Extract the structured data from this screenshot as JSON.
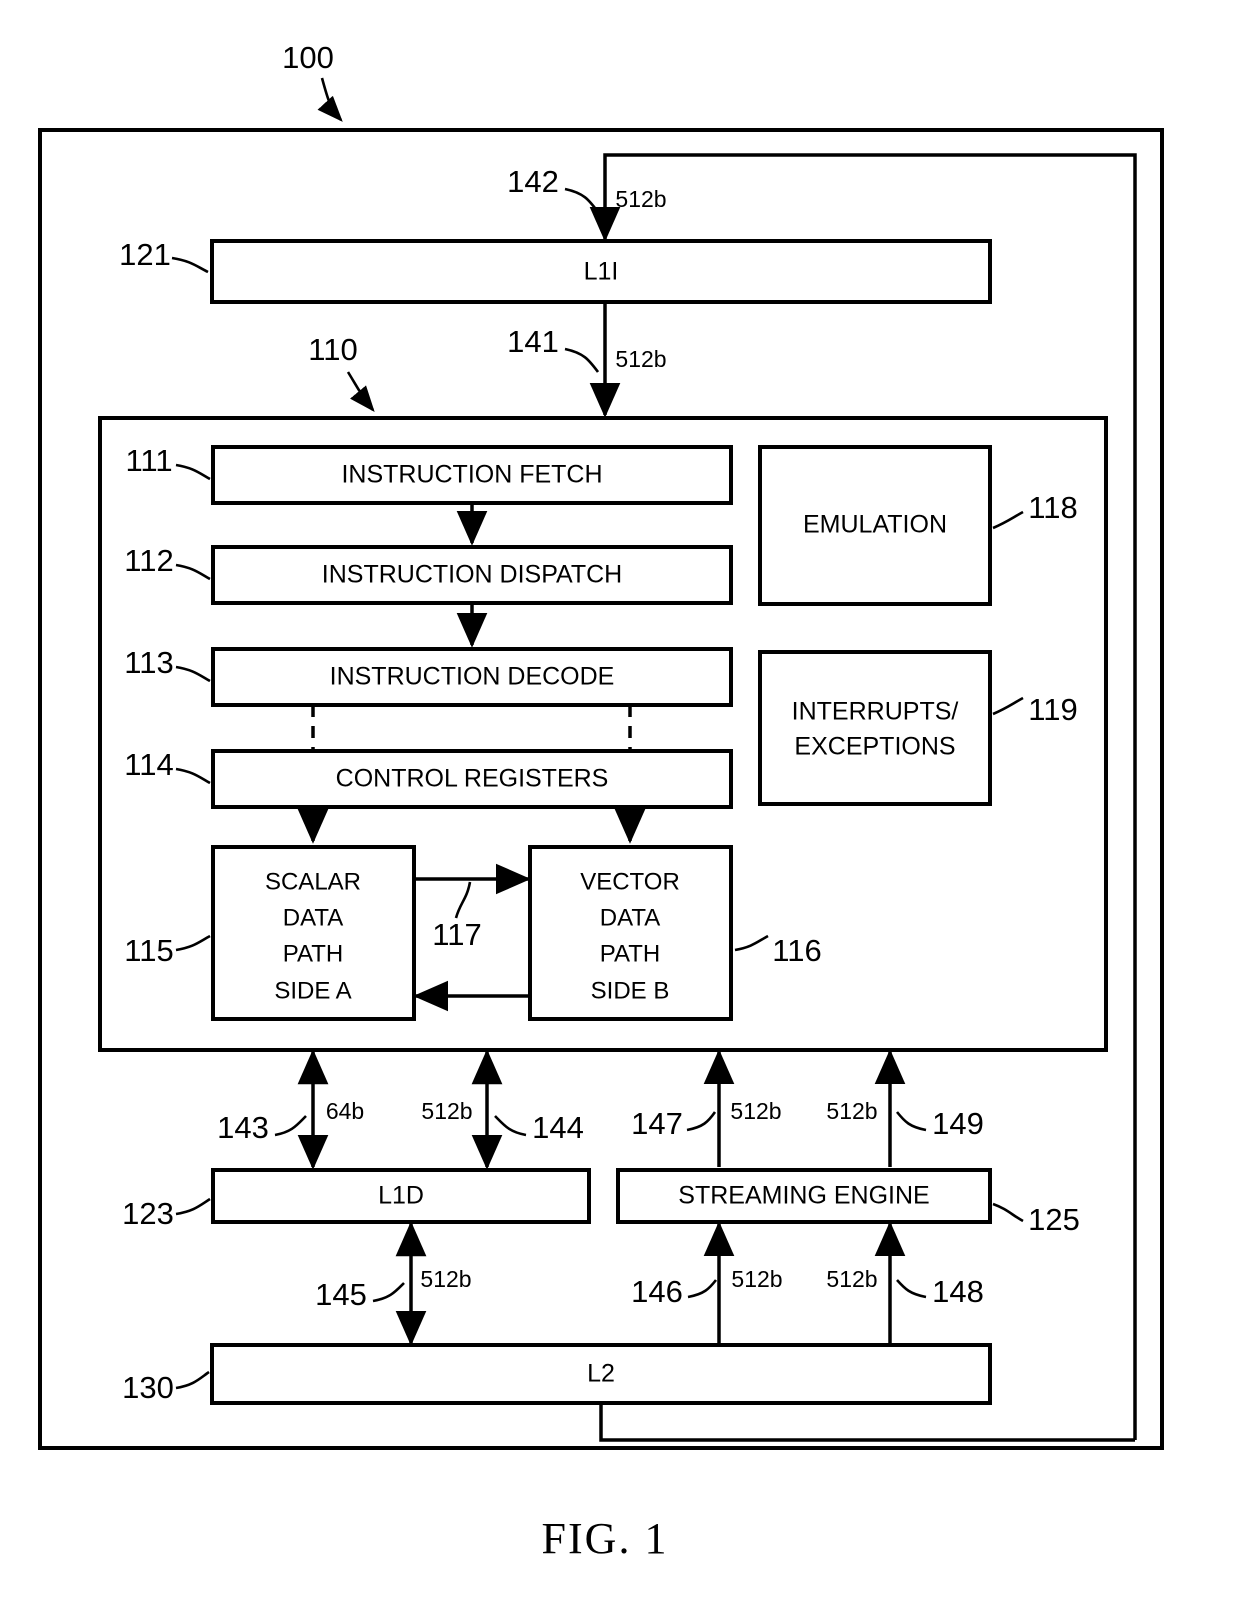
{
  "figure": {
    "caption": "FIG. 1",
    "system_ref": "100"
  },
  "blocks": {
    "l1i": {
      "label": "L1I",
      "ref": "121"
    },
    "cpu_core": {
      "ref": "110"
    },
    "instruction_fetch": {
      "label": "INSTRUCTION FETCH",
      "ref": "111"
    },
    "instruction_dispatch": {
      "label": "INSTRUCTION DISPATCH",
      "ref": "112"
    },
    "instruction_decode": {
      "label": "INSTRUCTION DECODE",
      "ref": "113"
    },
    "control_registers": {
      "label": "CONTROL REGISTERS",
      "ref": "114"
    },
    "scalar_data_path": {
      "line1": "SCALAR",
      "line2": "DATA",
      "line3": "PATH",
      "line4": "SIDE A",
      "ref": "115"
    },
    "vector_data_path": {
      "line1": "VECTOR",
      "line2": "DATA",
      "line3": "PATH",
      "line4": "SIDE B",
      "ref": "116"
    },
    "datapath_crosslink": {
      "ref": "117"
    },
    "emulation": {
      "label": "EMULATION",
      "ref": "118"
    },
    "interrupts_exceptions": {
      "line1": "INTERRUPTS/",
      "line2": "EXCEPTIONS",
      "ref": "119"
    },
    "l1d": {
      "label": "L1D",
      "ref": "123"
    },
    "streaming_engine": {
      "label": "STREAMING ENGINE",
      "ref": "125"
    },
    "l2": {
      "label": "L2",
      "ref": "130"
    }
  },
  "buses": [
    {
      "ref": "141",
      "width": "512b",
      "from": "l1i",
      "to": "cpu_core",
      "direction": "down"
    },
    {
      "ref": "142",
      "width": "512b",
      "from": "l2",
      "to": "l1i",
      "direction": "down"
    },
    {
      "ref": "143",
      "width": "64b",
      "from": "cpu_core",
      "to": "l1d",
      "direction": "both"
    },
    {
      "ref": "144",
      "width": "512b",
      "from": "cpu_core",
      "to": "l1d",
      "direction": "both"
    },
    {
      "ref": "145",
      "width": "512b",
      "from": "l1d",
      "to": "l2",
      "direction": "both"
    },
    {
      "ref": "146",
      "width": "512b",
      "from": "l2",
      "to": "streaming_engine",
      "direction": "up"
    },
    {
      "ref": "147",
      "width": "512b",
      "from": "streaming_engine",
      "to": "cpu_core",
      "direction": "up"
    },
    {
      "ref": "148",
      "width": "512b",
      "from": "l2",
      "to": "streaming_engine",
      "direction": "up"
    },
    {
      "ref": "149",
      "width": "512b",
      "from": "streaming_engine",
      "to": "cpu_core",
      "direction": "up"
    }
  ]
}
